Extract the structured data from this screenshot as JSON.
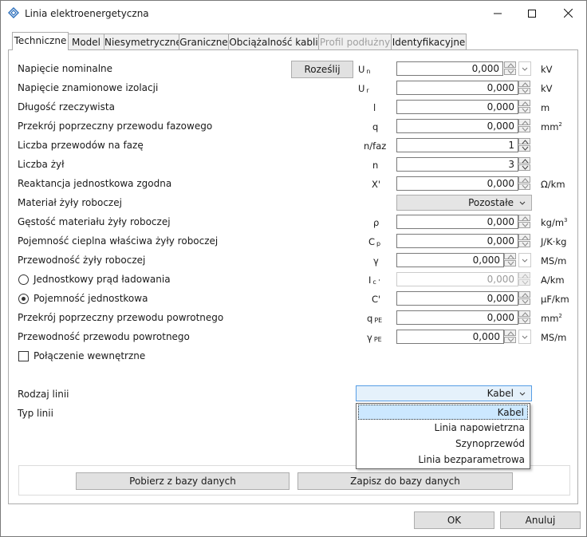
{
  "window": {
    "title": "Linia elektroenergetyczna"
  },
  "tabs": [
    {
      "label": "Techniczne"
    },
    {
      "label": "Model"
    },
    {
      "label": "Niesymetryczne"
    },
    {
      "label": "Graniczne"
    },
    {
      "label": "Obciążalność kabli"
    },
    {
      "label": "Profil podłużny"
    },
    {
      "label": "Identyfikacyjne"
    }
  ],
  "active_tab": "Techniczne",
  "fields": {
    "napiecie_nominalne": {
      "label": "Napięcie nominalne",
      "symbol": "U",
      "sub": "n",
      "value": "0,000",
      "unit": "kV"
    },
    "napiecie_izolacji": {
      "label": "Napięcie znamionowe izolacji",
      "symbol": "U",
      "sub": "r",
      "value": "0,000",
      "unit": "kV"
    },
    "dlugosc": {
      "label": "Długość rzeczywista",
      "symbol": "l",
      "value": "0,000",
      "unit": "m"
    },
    "przekroj": {
      "label": "Przekrój poprzeczny przewodu fazowego",
      "symbol": "q",
      "value": "0,000",
      "unit": "mm",
      "unit_sup": "2"
    },
    "liczba_przewodow": {
      "label": "Liczba przewodów na fazę",
      "symbol": "n/faz",
      "value": "1"
    },
    "liczba_zyl": {
      "label": "Liczba żył",
      "symbol": "n",
      "value": "3"
    },
    "reaktancja": {
      "label": "Reaktancja jednostkowa zgodna",
      "symbol": "X'",
      "value": "0,000",
      "unit": "Ω/km"
    },
    "material": {
      "label": "Materiał żyły roboczej",
      "value": "Pozostałe"
    },
    "gestosc": {
      "label": "Gęstość materiału żyły roboczej",
      "symbol": "ρ",
      "value": "0,000",
      "unit": "kg/m",
      "unit_sup": "3"
    },
    "pojemnosc_cieplna": {
      "label": "Pojemność cieplna właściwa żyły roboczej",
      "symbol": "C",
      "sub": "p",
      "value": "0,000",
      "unit": "J/K·kg"
    },
    "przewodnosc": {
      "label": "Przewodność żyły roboczej",
      "symbol": "γ",
      "value": "0,000",
      "unit": "MS/m"
    },
    "prad_ladowania": {
      "label": "Jednostkowy prąd ładowania",
      "symbol": "I",
      "sub": "c '",
      "value": "0,000",
      "unit": "A/km",
      "selected": false
    },
    "pojemnosc_jedn": {
      "label": "Pojemność jednostkowa",
      "symbol": "C'",
      "value": "0,000",
      "unit": "μF/km",
      "selected": true
    },
    "przekroj_pe": {
      "label": "Przekrój poprzeczny przewodu powrotnego",
      "symbol": "q",
      "sub": "PE",
      "value": "0,000",
      "unit": "mm",
      "unit_sup": "2"
    },
    "przewodnosc_pe": {
      "label": "Przewodność przewodu powrotnego",
      "symbol": "γ",
      "sub": "PE",
      "value": "0,000",
      "unit": "MS/m"
    },
    "polaczenie": {
      "label": "Połączenie wewnętrzne",
      "checked": false
    },
    "rodzaj_linii": {
      "label": "Rodzaj linii",
      "value": "Kabel"
    },
    "typ_linii": {
      "label": "Typ linii"
    }
  },
  "rozeslij_button": "Roześlij",
  "dropdown_options": [
    "Kabel",
    "Linia napowietrzna",
    "Szynoprzewód",
    "Linia bezparametrowa"
  ],
  "dropdown_selected": "Kabel",
  "buttons": {
    "pobierz": "Pobierz z bazy danych",
    "zapisz": "Zapisz do bazy danych",
    "ok": "OK",
    "anuluj": "Anuluj"
  }
}
